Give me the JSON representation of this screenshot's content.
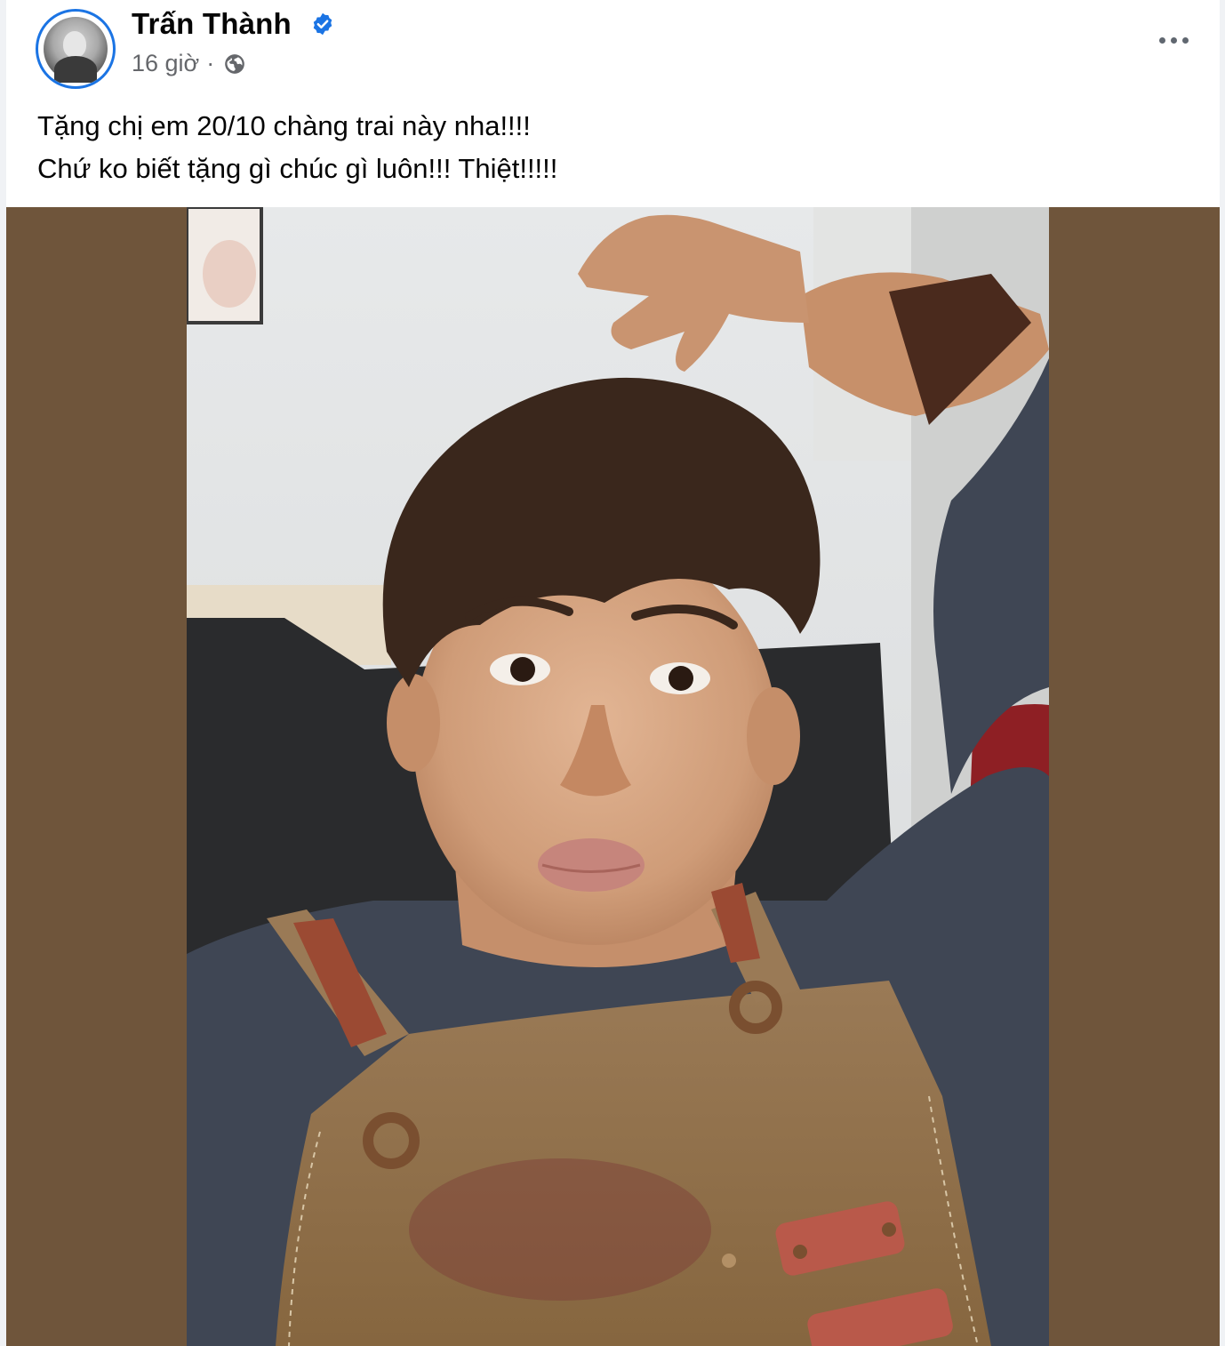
{
  "post": {
    "author": "Trấn Thành",
    "timestamp": "16 giờ",
    "separator": "·",
    "privacy_icon": "globe-icon",
    "verified_icon": "verified-badge-icon",
    "text_lines": [
      "Tặng chị em 20/10 chàng trai này nha!!!!",
      "Chứ ko biết tặng gì chúc gì luôn!!! Thiệt!!!!!"
    ],
    "more_icon": "more-options-icon"
  },
  "colors": {
    "accent": "#1b74e4",
    "photo_background": "#6f553b",
    "secondary_text": "#65676b"
  }
}
